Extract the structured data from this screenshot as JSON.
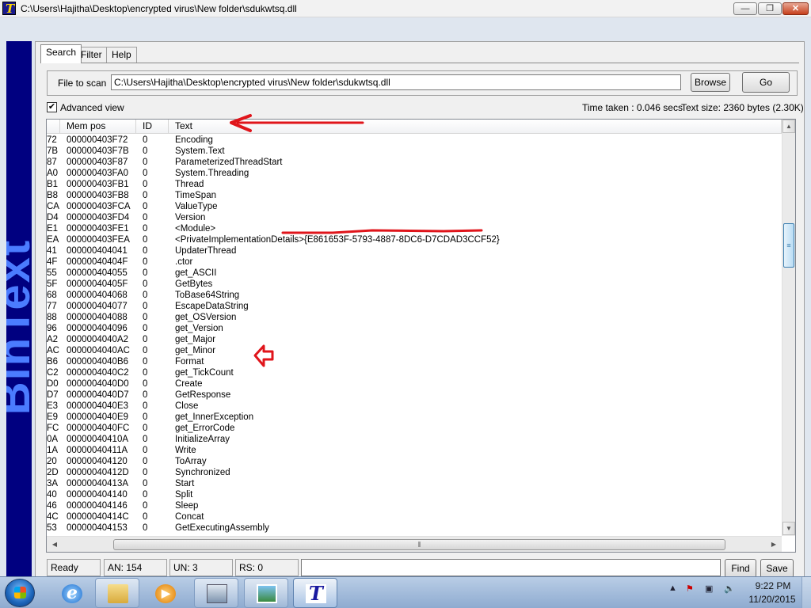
{
  "window": {
    "title": "C:\\Users\\Hajitha\\Desktop\\encrypted virus\\New folder\\sdukwtsq.dll",
    "app_icon_letter": "T",
    "minimize": "—",
    "maximize": "❐",
    "close": "✕"
  },
  "sidebar": {
    "brand": "BinText"
  },
  "tabs": [
    {
      "label": "Search",
      "active": true
    },
    {
      "label": "Filter",
      "active": false
    },
    {
      "label": "Help",
      "active": false
    }
  ],
  "scan": {
    "label": "File to scan",
    "value": "C:\\Users\\Hajitha\\Desktop\\encrypted virus\\New folder\\sdukwtsq.dll",
    "browse": "Browse",
    "go": "Go"
  },
  "advanced": {
    "checked": true,
    "mark": "✔",
    "label": "Advanced view"
  },
  "stats": {
    "time_taken": "Time taken : 0.046 secs",
    "text_size": "Text size: 2360 bytes (2.30K)"
  },
  "columns": [
    "Mem pos",
    "ID",
    "Text"
  ],
  "rows": [
    {
      "off": "72",
      "mem": "000000403F72",
      "id": "0",
      "text": "Encoding"
    },
    {
      "off": "7B",
      "mem": "000000403F7B",
      "id": "0",
      "text": "System.Text"
    },
    {
      "off": "87",
      "mem": "000000403F87",
      "id": "0",
      "text": "ParameterizedThreadStart"
    },
    {
      "off": "A0",
      "mem": "000000403FA0",
      "id": "0",
      "text": "System.Threading"
    },
    {
      "off": "B1",
      "mem": "000000403FB1",
      "id": "0",
      "text": "Thread"
    },
    {
      "off": "B8",
      "mem": "000000403FB8",
      "id": "0",
      "text": "TimeSpan"
    },
    {
      "off": "CA",
      "mem": "000000403FCA",
      "id": "0",
      "text": "ValueType"
    },
    {
      "off": "D4",
      "mem": "000000403FD4",
      "id": "0",
      "text": "Version"
    },
    {
      "off": "E1",
      "mem": "000000403FE1",
      "id": "0",
      "text": "<Module>"
    },
    {
      "off": "EA",
      "mem": "000000403FEA",
      "id": "0",
      "text": "<PrivateImplementationDetails>{E861653F-5793-4887-8DC6-D7CDAD3CCF52}"
    },
    {
      "off": "41",
      "mem": "000000404041",
      "id": "0",
      "text": "UpdaterThread"
    },
    {
      "off": "4F",
      "mem": "00000040404F",
      "id": "0",
      "text": ".ctor"
    },
    {
      "off": "55",
      "mem": "000000404055",
      "id": "0",
      "text": "get_ASCII"
    },
    {
      "off": "5F",
      "mem": "00000040405F",
      "id": "0",
      "text": "GetBytes"
    },
    {
      "off": "68",
      "mem": "000000404068",
      "id": "0",
      "text": "ToBase64String"
    },
    {
      "off": "77",
      "mem": "000000404077",
      "id": "0",
      "text": "EscapeDataString"
    },
    {
      "off": "88",
      "mem": "000000404088",
      "id": "0",
      "text": "get_OSVersion"
    },
    {
      "off": "96",
      "mem": "000000404096",
      "id": "0",
      "text": "get_Version"
    },
    {
      "off": "A2",
      "mem": "0000004040A2",
      "id": "0",
      "text": "get_Major"
    },
    {
      "off": "AC",
      "mem": "0000004040AC",
      "id": "0",
      "text": "get_Minor"
    },
    {
      "off": "B6",
      "mem": "0000004040B6",
      "id": "0",
      "text": "Format"
    },
    {
      "off": "C2",
      "mem": "0000004040C2",
      "id": "0",
      "text": "get_TickCount"
    },
    {
      "off": "D0",
      "mem": "0000004040D0",
      "id": "0",
      "text": "Create"
    },
    {
      "off": "D7",
      "mem": "0000004040D7",
      "id": "0",
      "text": "GetResponse"
    },
    {
      "off": "E3",
      "mem": "0000004040E3",
      "id": "0",
      "text": "Close"
    },
    {
      "off": "E9",
      "mem": "0000004040E9",
      "id": "0",
      "text": "get_InnerException"
    },
    {
      "off": "FC",
      "mem": "0000004040FC",
      "id": "0",
      "text": "get_ErrorCode"
    },
    {
      "off": "0A",
      "mem": "00000040410A",
      "id": "0",
      "text": "InitializeArray"
    },
    {
      "off": "1A",
      "mem": "00000040411A",
      "id": "0",
      "text": "Write"
    },
    {
      "off": "20",
      "mem": "000000404120",
      "id": "0",
      "text": "ToArray"
    },
    {
      "off": "2D",
      "mem": "00000040412D",
      "id": "0",
      "text": "Synchronized"
    },
    {
      "off": "3A",
      "mem": "00000040413A",
      "id": "0",
      "text": "Start"
    },
    {
      "off": "40",
      "mem": "000000404140",
      "id": "0",
      "text": "Split"
    },
    {
      "off": "46",
      "mem": "000000404146",
      "id": "0",
      "text": "Sleep"
    },
    {
      "off": "4C",
      "mem": "00000040414C",
      "id": "0",
      "text": "Concat"
    },
    {
      "off": "53",
      "mem": "000000404153",
      "id": "0",
      "text": "GetExecutingAssembly"
    }
  ],
  "statusbar": {
    "ready": "Ready",
    "an": "AN: 154",
    "un": "UN: 3",
    "rs": "RS: 0",
    "find": "Find",
    "save": "Save"
  },
  "taskbar": {
    "items": [
      "windows-start",
      "internet-explorer",
      "windows-explorer",
      "media-player",
      "network-computer",
      "image-viewer",
      "bintext"
    ],
    "clock_time": "9:22 PM",
    "clock_date": "11/20/2015"
  },
  "colors": {
    "sidebar_bg": "#000080",
    "sidebar_text": "#4b7cff",
    "annotation": "#e0151b",
    "close_button": "#c7401c"
  }
}
